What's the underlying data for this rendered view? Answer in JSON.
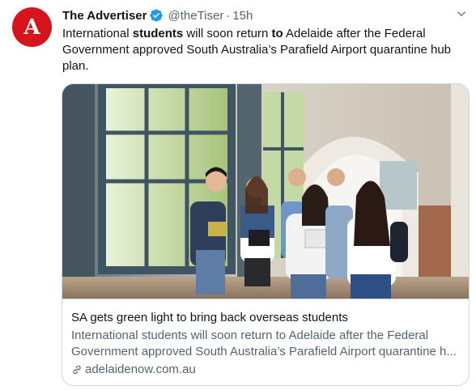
{
  "account": {
    "avatar_letter": "A",
    "avatar_color": "#d5151b",
    "name": "The Advertiser",
    "handle": "@theTiser",
    "separator": "·",
    "time": "15h"
  },
  "tweet": {
    "segments": [
      {
        "text": "International ",
        "bold": false
      },
      {
        "text": "students",
        "bold": true
      },
      {
        "text": " will soon return ",
        "bold": false
      },
      {
        "text": "to",
        "bold": true
      },
      {
        "text": " Adelaide after the Federal Government approved South Australia’s Parafield Airport quarantine hub plan.",
        "bold": false
      }
    ]
  },
  "card": {
    "title": "SA gets green light to bring back overseas students",
    "description": "International students will soon return to Adelaide after the Federal Government approved South Australia’s Parafield Airport quarantine h...",
    "domain": "adelaidenow.com.au",
    "image_icon": "photo-students-walking-corridor"
  },
  "colors": {
    "text": "#0f1419",
    "secondary": "#536471",
    "border": "#cfd9de",
    "verified": "#1d9bf0"
  }
}
